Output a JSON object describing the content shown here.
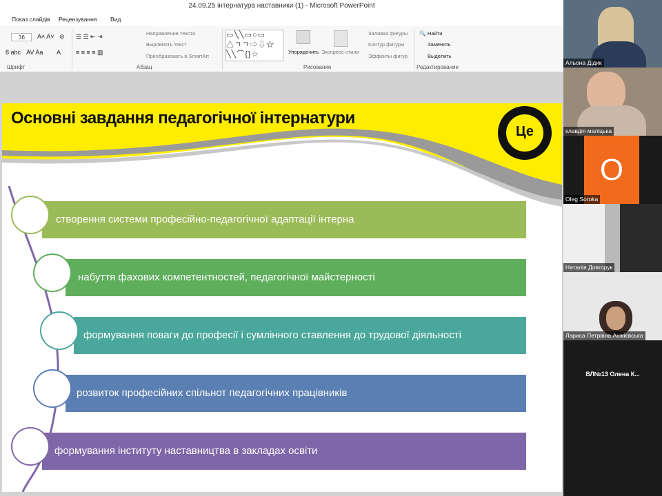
{
  "window": {
    "title": "24.09.25 інтернатура наставники (1)  -  Microsoft PowerPoint"
  },
  "ribbon_tabs": [
    "Показ слайдів",
    "Рецензування",
    "Вид"
  ],
  "ribbon": {
    "font_size": "36",
    "groups": {
      "font": "Шрифт",
      "paragraph": "Абзац",
      "drawing": "Рисование",
      "editing": "Редактирование"
    },
    "text_direction": "Направление текста",
    "align_text": "Выровнять текст",
    "smartart": "Преобразовать в SmartArt",
    "arrange": "Упорядочить",
    "quick_styles": "Экспресс-стили",
    "shape_fill": "Заливка фигуры",
    "shape_outline": "Контур фигуры",
    "shape_effects": "Эффекты фигур",
    "find": "Найти",
    "replace": "Заменить",
    "select": "Выделить"
  },
  "slide": {
    "title": "Основні завдання педагогічної інтернатури",
    "logo_text": "Це",
    "items": [
      {
        "text": "створення системи професійно-педагогічної адаптації інтерна",
        "color": "#9bbb59"
      },
      {
        "text": "набуття фахових компетентностей, педагогічної майстерності",
        "color": "#5fae5c"
      },
      {
        "text": "формування поваги до професії і сумлінного ставлення до трудової діяльності",
        "color": "#4aa79b"
      },
      {
        "text": "розвиток професійних спільнот педагогічних працівників",
        "color": "#5b7fb3"
      },
      {
        "text": "формування інституту наставництва в закладах освіти",
        "color": "#7f66a8"
      }
    ]
  },
  "participants": [
    {
      "name": "Альона Дідик"
    },
    {
      "name": "клавдія маліцька"
    },
    {
      "name": "Oleg Soroka",
      "avatar_letter": "O",
      "avatar_color": "#f26a1b"
    },
    {
      "name": "Наталія Довгорук"
    },
    {
      "name": "Лариса Петрівна Анжієвська"
    },
    {
      "name": "ВЛ№13 Олена К..."
    }
  ]
}
